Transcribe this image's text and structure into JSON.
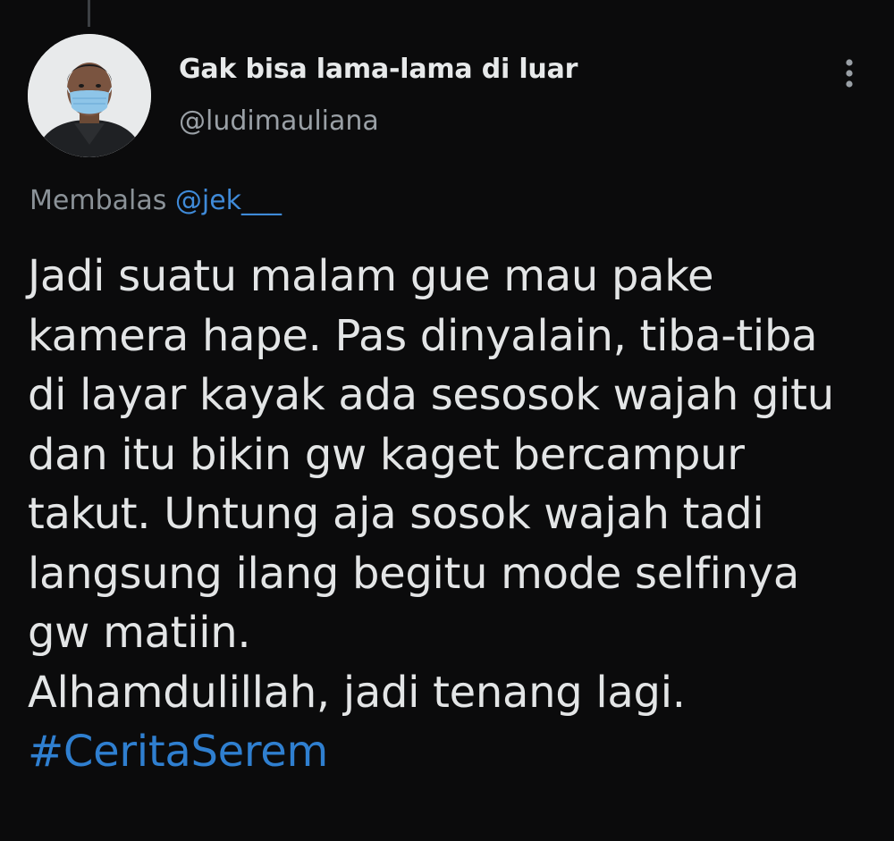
{
  "tweet": {
    "display_name": "Gak bisa lama-lama di luar",
    "handle": "@ludimauliana",
    "reply_prefix": "Membalas",
    "reply_mention": "@jek___",
    "body_lines": [
      "Jadi suatu malam gue mau pake",
      "kamera hape. Pas dinyalain, tiba-tiba",
      "di layar kayak ada sesosok wajah gitu",
      "dan itu bikin gw kaget bercampur",
      "takut. Untung aja sosok wajah tadi",
      "langsung ilang begitu mode selfinya",
      "gw matiin.",
      "Alhamdulillah, jadi tenang lagi."
    ],
    "hashtag": "#CeritaSerem",
    "more_icon": "vertical-ellipsis-icon"
  },
  "colors": {
    "background": "#0b0b0c",
    "text_primary": "#e7e9ea",
    "text_secondary": "#9aa0a6",
    "link": "#2f7fd0"
  }
}
